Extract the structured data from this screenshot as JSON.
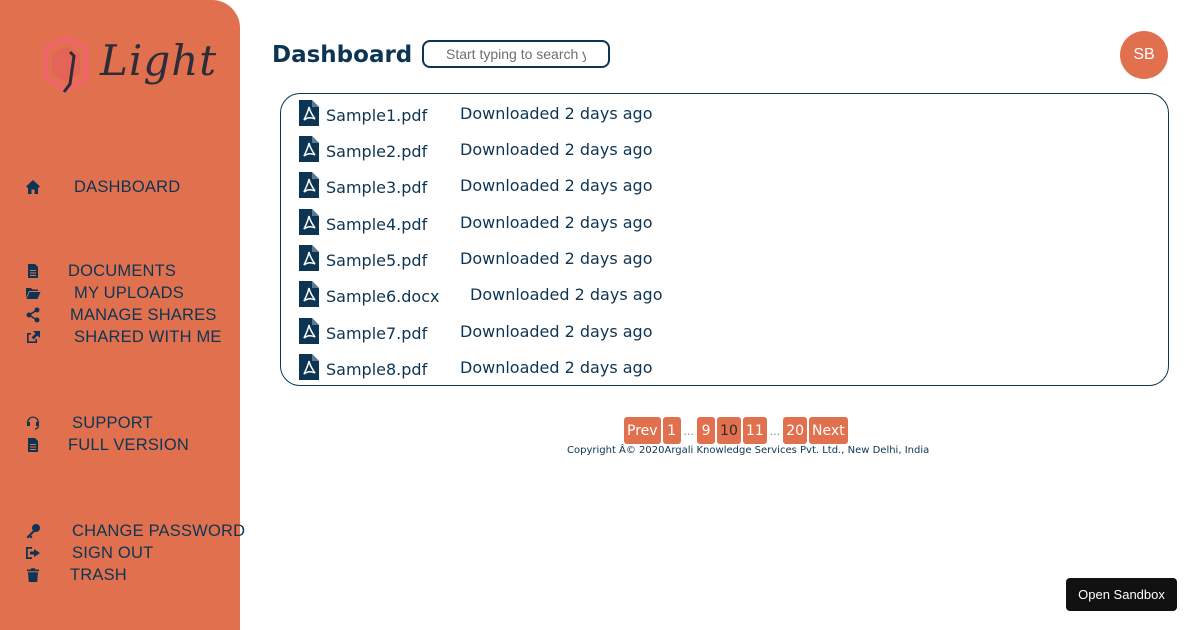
{
  "logo": {
    "text": "Light"
  },
  "nav": {
    "dashboard": "DASHBOARD",
    "documents": "DOCUMENTS",
    "my_uploads": "MY UPLOADS",
    "manage_shares": "MANAGE SHARES",
    "shared_with_me": "SHARED WITH ME",
    "support": "SUPPORT",
    "full_version": "FULL VERSION",
    "change_password": "CHANGE PASSWORD",
    "sign_out": "SIGN OUT",
    "trash": "TRASH"
  },
  "header": {
    "title": "Dashboard",
    "search_placeholder": "Start typing to search y",
    "avatar_initials": "SB"
  },
  "files": [
    {
      "name": "Sample1.pdf",
      "status": "Downloaded 2 days ago"
    },
    {
      "name": "Sample2.pdf",
      "status": "Downloaded 2 days ago"
    },
    {
      "name": "Sample3.pdf",
      "status": "Downloaded 2 days ago"
    },
    {
      "name": "Sample4.pdf",
      "status": "Downloaded 2 days ago"
    },
    {
      "name": "Sample5.pdf",
      "status": "Downloaded 2 days ago"
    },
    {
      "name": "Sample6.docx",
      "status": "Downloaded 2 days ago"
    },
    {
      "name": "Sample7.pdf",
      "status": "Downloaded 2 days ago"
    },
    {
      "name": "Sample8.pdf",
      "status": "Downloaded 2 days ago"
    }
  ],
  "pagination": {
    "prev": "Prev",
    "p1": "1",
    "ellipsis": "...",
    "p9": "9",
    "p10": "10",
    "p11": "11",
    "p20": "20",
    "next": "Next"
  },
  "footer": {
    "copyright": "Copyright Â© 2020Argali Knowledge Services Pvt. Ltd., New Delhi, India"
  },
  "sandbox": {
    "label": "Open Sandbox"
  },
  "colors": {
    "accent": "#e1704f",
    "text": "#0d3553",
    "sandbox": "#111111"
  }
}
